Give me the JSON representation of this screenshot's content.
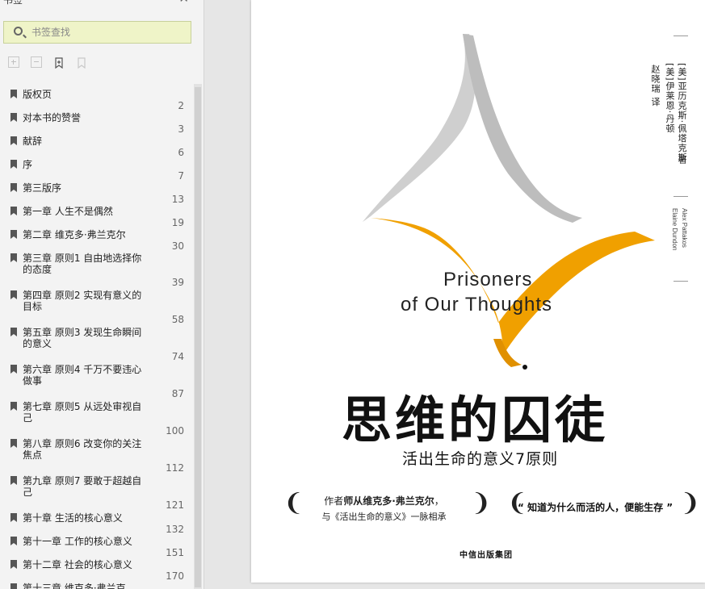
{
  "sidebar": {
    "title": "书签",
    "close_icon": "close-icon",
    "search_placeholder": "书签查找",
    "toolbar": [
      "expand-all-icon",
      "collapse-all-icon",
      "add-bookmark-icon",
      "delete-bookmark-icon"
    ],
    "items": [
      {
        "label": "版权页",
        "page": "2"
      },
      {
        "label": "对本书的赞誉",
        "page": "3"
      },
      {
        "label": "献辞",
        "page": "6"
      },
      {
        "label": "序",
        "page": "7"
      },
      {
        "label": "第三版序",
        "page": "13"
      },
      {
        "label": "第一章 人生不是偶然",
        "page": "19"
      },
      {
        "label": "第二章 维克多·弗兰克尔",
        "page": "30"
      },
      {
        "label": "第三章 原则1 自由地选择你的态度",
        "page": "39"
      },
      {
        "label": "第四章 原则2 实现有意义的目标",
        "page": "58"
      },
      {
        "label": "第五章 原则3 发现生命瞬间的意义",
        "page": "74"
      },
      {
        "label": "第六章 原则4 千万不要违心做事",
        "page": "87"
      },
      {
        "label": "第七章 原则5 从远处审视自己",
        "page": "100"
      },
      {
        "label": "第八章 原则6 改变你的关注焦点",
        "page": "112"
      },
      {
        "label": "第九章 原则7 要敢于超越自己",
        "page": "121"
      },
      {
        "label": "第十章 生活的核心意义",
        "page": "132"
      },
      {
        "label": "第十一章 工作的核心意义",
        "page": "151"
      },
      {
        "label": "第十二章 社会的核心意义",
        "page": "170"
      },
      {
        "label": "第十三章 维克多·弗兰克",
        "page": ""
      }
    ]
  },
  "cover": {
    "author1": "[美]亚历克斯·佩塔克斯",
    "author2": "[美]伊莱恩·丹顿",
    "author_suffix": "著",
    "translator": "赵晓瑞 译",
    "en_author1": "Alex Pattakos",
    "en_author2": "Elaine Dundon",
    "en_title_line1": "Prisoners",
    "en_title_line2": "of Our Thoughts",
    "title": "思维的囚徒",
    "subtitle": "活出生命的意义7原则",
    "blurb_prefix": "作者",
    "blurb_bold": "师从维克多·弗兰克尔",
    "blurb_suffix": "，",
    "blurb_line2": "与《活出生命的意义》一脉相承",
    "quote": "“ 知道为什么而活的人，便能生存 ”",
    "publisher": "中信出版集团",
    "accent_color": "#f0a000"
  }
}
